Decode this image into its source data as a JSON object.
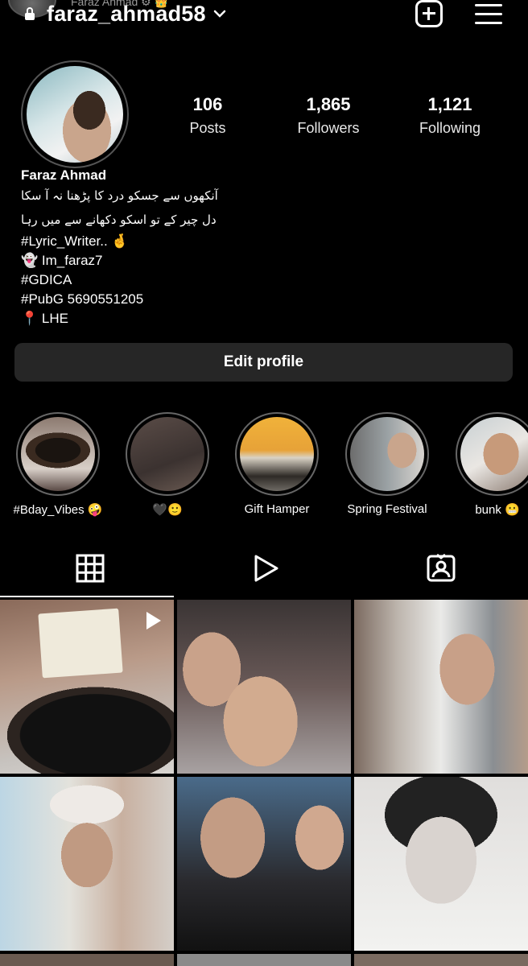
{
  "header": {
    "ghost_label": "Faraz Ahmad ⚙ 👑",
    "username": "faraz_ahmad58"
  },
  "stats": [
    {
      "value": "106",
      "label": "Posts"
    },
    {
      "value": "1,865",
      "label": "Followers"
    },
    {
      "value": "1,121",
      "label": "Following"
    }
  ],
  "bio": {
    "name": "Faraz Ahmad",
    "lines": [
      "آنکھوں سے جسکو درد کا پڑھنا نہ آ سکا",
      "دل چیر کے تو اسکو دکھانے سے میں رہا",
      "#Lyric_Writer.. 🤞",
      "👻 Im_faraz7",
      "#GDICA",
      "#PubG 5690551205",
      "📍 LHE"
    ]
  },
  "edit_profile_label": "Edit profile",
  "highlights": [
    {
      "caption": "#Bday_Vibes 🤪"
    },
    {
      "caption": "🖤🙂"
    },
    {
      "caption": "Gift Hamper"
    },
    {
      "caption": "Spring Festival"
    },
    {
      "caption": "bunk 😬"
    }
  ],
  "tabs": [
    "grid",
    "reels",
    "tagged"
  ],
  "colors": {
    "background": "#000000",
    "button": "#262626",
    "text": "#ffffff"
  }
}
